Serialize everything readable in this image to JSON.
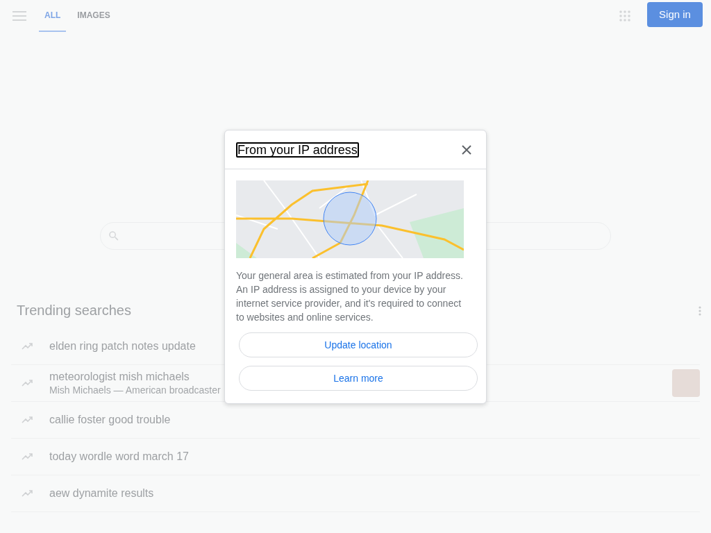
{
  "header": {
    "tabs": [
      {
        "label": "ALL",
        "selected": true
      },
      {
        "label": "IMAGES",
        "selected": false
      }
    ],
    "sign_in": "Sign in"
  },
  "trending": {
    "title": "Trending searches",
    "items": [
      {
        "title": "elden ring patch notes update",
        "photo": false
      },
      {
        "title": "meteorologist mish michaels",
        "subtitle": "Mish Michaels — American broadcaster",
        "photo": true
      },
      {
        "title": "callie foster good trouble",
        "photo": false
      },
      {
        "title": "today wordle word march 17",
        "photo": false
      },
      {
        "title": "aew dynamite results",
        "photo": false
      }
    ]
  },
  "dialog": {
    "title": "From your IP address",
    "text": "Your general area is estimated from your IP address. An IP address is assigned to your device by your internet service provider, and it's required to connect to websites and online services.",
    "buttons": [
      "Update location",
      "Learn more"
    ]
  }
}
